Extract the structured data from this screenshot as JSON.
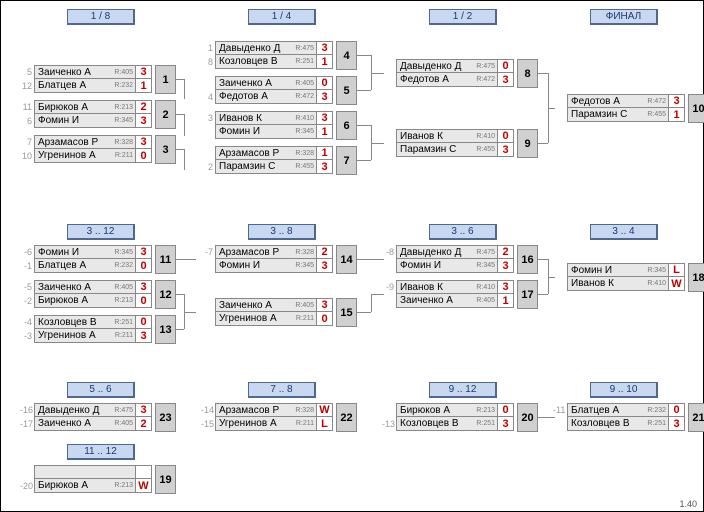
{
  "rounds": {
    "r18": "1 / 8",
    "r14": "1 / 4",
    "r12": "1 / 2",
    "final": "ФИНАЛ",
    "r3_12": "3 .. 12",
    "r3_8": "3 .. 8",
    "r3_6": "3 .. 6",
    "r3_4": "3 .. 4",
    "r5_6": "5 .. 6",
    "r7_8": "7 .. 8",
    "r9_12": "9 .. 12",
    "r9_10": "9 .. 10",
    "r11_12": "11 .. 12"
  },
  "matches": {
    "m1": {
      "num": "1",
      "s1": "5",
      "s2": "12",
      "p1": "Заиченко А",
      "r1": "R:405",
      "sc1": "3",
      "p2": "Блатцев А",
      "r2": "R:232",
      "sc2": "1"
    },
    "m2": {
      "num": "2",
      "s1": "11",
      "s2": "6",
      "p1": "Бирюков А",
      "r1": "R:213",
      "sc1": "2",
      "p2": "Фомин И",
      "r2": "R:345",
      "sc2": "3"
    },
    "m3": {
      "num": "3",
      "s1": "7",
      "s2": "10",
      "p1": "Арзамасов Р",
      "r1": "R:328",
      "sc1": "3",
      "p2": "Угренинов А",
      "r2": "R:211",
      "sc2": "0"
    },
    "m4": {
      "num": "4",
      "s1": "1",
      "s2": "8",
      "p1": "Давыденко Д",
      "r1": "R:475",
      "sc1": "3",
      "p2": "Козловцев В",
      "r2": "R:251",
      "sc2": "1"
    },
    "m5": {
      "num": "5",
      "s1": "",
      "s2": "4",
      "p1": "Заиченко А",
      "r1": "R:405",
      "sc1": "0",
      "p2": "Федотов А",
      "r2": "R:472",
      "sc2": "3"
    },
    "m6": {
      "num": "6",
      "s1": "3",
      "s2": "",
      "p1": "Иванов К",
      "r1": "R:410",
      "sc1": "3",
      "p2": "Фомин И",
      "r2": "R:345",
      "sc2": "1"
    },
    "m7": {
      "num": "7",
      "s1": "",
      "s2": "2",
      "p1": "Арзамасов Р",
      "r1": "R:328",
      "sc1": "1",
      "p2": "Парамзин С",
      "r2": "R:455",
      "sc2": "3"
    },
    "m8": {
      "num": "8",
      "s1": "",
      "s2": "",
      "p1": "Давыденко Д",
      "r1": "R:475",
      "sc1": "0",
      "p2": "Федотов А",
      "r2": "R:472",
      "sc2": "3"
    },
    "m9": {
      "num": "9",
      "s1": "",
      "s2": "",
      "p1": "Иванов К",
      "r1": "R:410",
      "sc1": "0",
      "p2": "Парамзин С",
      "r2": "R:455",
      "sc2": "3"
    },
    "m10": {
      "num": "10",
      "s1": "",
      "s2": "",
      "p1": "Федотов А",
      "r1": "R:472",
      "sc1": "3",
      "p2": "Парамзин С",
      "r2": "R:455",
      "sc2": "1"
    },
    "m11": {
      "num": "11",
      "s1": "-6",
      "s2": "-1",
      "p1": "Фомин И",
      "r1": "R:345",
      "sc1": "3",
      "p2": "Блатцев А",
      "r2": "R:232",
      "sc2": "0"
    },
    "m12": {
      "num": "12",
      "s1": "-5",
      "s2": "-2",
      "p1": "Заиченко А",
      "r1": "R:405",
      "sc1": "3",
      "p2": "Бирюков А",
      "r2": "R:213",
      "sc2": "0"
    },
    "m13": {
      "num": "13",
      "s1": "-4",
      "s2": "-3",
      "p1": "Козловцев В",
      "r1": "R:251",
      "sc1": "0",
      "p2": "Угренинов А",
      "r2": "R:211",
      "sc2": "3"
    },
    "m14": {
      "num": "14",
      "s1": "-7",
      "s2": "",
      "p1": "Арзамасов Р",
      "r1": "R:328",
      "sc1": "2",
      "p2": "Фомин И",
      "r2": "R:345",
      "sc2": "3"
    },
    "m15": {
      "num": "15",
      "s1": "",
      "s2": "",
      "p1": "Заиченко А",
      "r1": "R:405",
      "sc1": "3",
      "p2": "Угренинов А",
      "r2": "R:211",
      "sc2": "0"
    },
    "m16": {
      "num": "16",
      "s1": "-8",
      "s2": "",
      "p1": "Давыденко Д",
      "r1": "R:475",
      "sc1": "2",
      "p2": "Фомин И",
      "r2": "R:345",
      "sc2": "3"
    },
    "m17": {
      "num": "17",
      "s1": "-9",
      "s2": "",
      "p1": "Иванов К",
      "r1": "R:410",
      "sc1": "3",
      "p2": "Заиченко А",
      "r2": "R:405",
      "sc2": "1"
    },
    "m18": {
      "num": "18",
      "s1": "",
      "s2": "",
      "p1": "Фомин И",
      "r1": "R:345",
      "sc1": "L",
      "p2": "Иванов К",
      "r2": "R:410",
      "sc2": "W"
    },
    "m19": {
      "num": "19",
      "s1": "",
      "s2": "-20",
      "p1": "",
      "r1": "",
      "sc1": "",
      "p2": "Бирюков А",
      "r2": "R:213",
      "sc2": "W"
    },
    "m20": {
      "num": "20",
      "s1": "",
      "s2": "-13",
      "p1": "Бирюков А",
      "r1": "R:213",
      "sc1": "0",
      "p2": "Козловцев В",
      "r2": "R:251",
      "sc2": "3"
    },
    "m21": {
      "num": "21",
      "s1": "-11",
      "s2": "",
      "p1": "Блатцев А",
      "r1": "R:232",
      "sc1": "0",
      "p2": "Козловцев В",
      "r2": "R:251",
      "sc2": "3"
    },
    "m22": {
      "num": "22",
      "s1": "-14",
      "s2": "-15",
      "p1": "Арзамасов Р",
      "r1": "R:328",
      "sc1": "W",
      "p2": "Угренинов А",
      "r2": "R:211",
      "sc2": "L"
    },
    "m23": {
      "num": "23",
      "s1": "-16",
      "s2": "-17",
      "p1": "Давыденко Д",
      "r1": "R:475",
      "sc1": "3",
      "p2": "Заиченко А",
      "r2": "R:405",
      "sc2": "2"
    }
  },
  "version": "1.40"
}
